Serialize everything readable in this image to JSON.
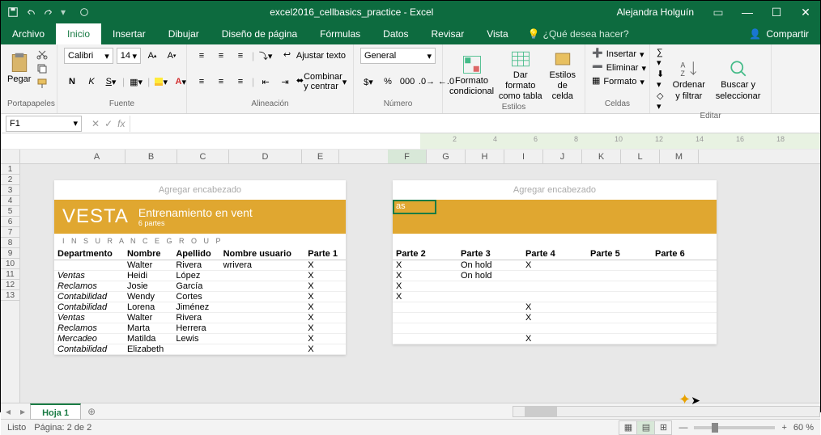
{
  "titlebar": {
    "title": "excel2016_cellbasics_practice - Excel",
    "user": "Alejandra Holguín"
  },
  "tabs": {
    "file": "Archivo",
    "home": "Inicio",
    "insert": "Insertar",
    "draw": "Dibujar",
    "layout": "Diseño de página",
    "formulas": "Fórmulas",
    "data": "Datos",
    "review": "Revisar",
    "view": "Vista",
    "tellme": "¿Qué desea hacer?",
    "share": "Compartir"
  },
  "ribbon": {
    "clipboard": {
      "paste": "Pegar",
      "label": "Portapapeles"
    },
    "font": {
      "name": "Calibri",
      "size": "14",
      "label": "Fuente",
      "bold": "N",
      "italic": "K",
      "underline": "S"
    },
    "align": {
      "wrap": "Ajustar texto",
      "merge": "Combinar y centrar",
      "label": "Alineación"
    },
    "number": {
      "format": "General",
      "label": "Número"
    },
    "styles": {
      "cond": "Formato condicional",
      "table": "Dar formato como tabla",
      "cell": "Estilos de celda",
      "label": "Estilos"
    },
    "cells": {
      "insert": "Insertar",
      "delete": "Eliminar",
      "format": "Formato",
      "label": "Celdas"
    },
    "editing": {
      "sort": "Ordenar y filtrar",
      "find": "Buscar y seleccionar",
      "label": "Editar"
    }
  },
  "formula": {
    "namebox": "F1"
  },
  "cols": {
    "left": [
      "A",
      "B",
      "C",
      "D",
      "E"
    ],
    "right": [
      "F",
      "G",
      "H",
      "I",
      "J",
      "K",
      "L",
      "M"
    ]
  },
  "rows": [
    "1",
    "2",
    "3",
    "4",
    "5",
    "6",
    "7",
    "8",
    "9",
    "10",
    "11",
    "12",
    "13"
  ],
  "pageL": {
    "header": "Agregar encabezado",
    "company": "VESTA",
    "igroup": "I N S U R A N C E    G R O U P",
    "bannerTitle": "Entrenamiento en vent",
    "bannerSub": "6 partes",
    "th": [
      "Departmento",
      "Nombre",
      "Apellido",
      "Nombre usuario",
      "Parte 1"
    ],
    "rows": [
      [
        "",
        "Walter",
        "Rivera",
        "wrivera",
        "X"
      ],
      [
        "Ventas",
        "Heidi",
        "López",
        "",
        "X"
      ],
      [
        "Reclamos",
        "Josie",
        "García",
        "",
        "X"
      ],
      [
        "Contabilidad",
        "Wendy",
        "Cortes",
        "",
        "X"
      ],
      [
        "Contabilidad",
        "Lorena",
        "Jiménez",
        "",
        "X"
      ],
      [
        "Ventas",
        "Walter",
        "Rivera",
        "",
        "X"
      ],
      [
        "Reclamos",
        "Marta",
        "Herrera",
        "",
        "X"
      ],
      [
        "Mercadeo",
        "Matilda",
        "Lewis",
        "",
        "X"
      ],
      [
        "Contabilidad",
        "Elizabeth",
        "",
        "",
        "X"
      ]
    ]
  },
  "pageR": {
    "header": "Agregar encabezado",
    "selcell": "as",
    "th": [
      "Parte 2",
      "Parte 3",
      "Parte 4",
      "Parte 5",
      "Parte 6"
    ],
    "rows": [
      [
        "X",
        "On hold",
        "X",
        "",
        ""
      ],
      [
        "X",
        "On hold",
        "",
        "",
        ""
      ],
      [
        "X",
        "",
        "",
        "",
        ""
      ],
      [
        "X",
        "",
        "",
        "",
        ""
      ],
      [
        "",
        "",
        "X",
        "",
        ""
      ],
      [
        "",
        "",
        "X",
        "",
        ""
      ],
      [
        "",
        "",
        "",
        "",
        ""
      ],
      [
        "",
        "",
        "X",
        "",
        ""
      ]
    ]
  },
  "sheet": {
    "tab1": "Hoja 1"
  },
  "status": {
    "ready": "Listo",
    "page": "Página: 2 de 2",
    "zoom": "60 %"
  }
}
